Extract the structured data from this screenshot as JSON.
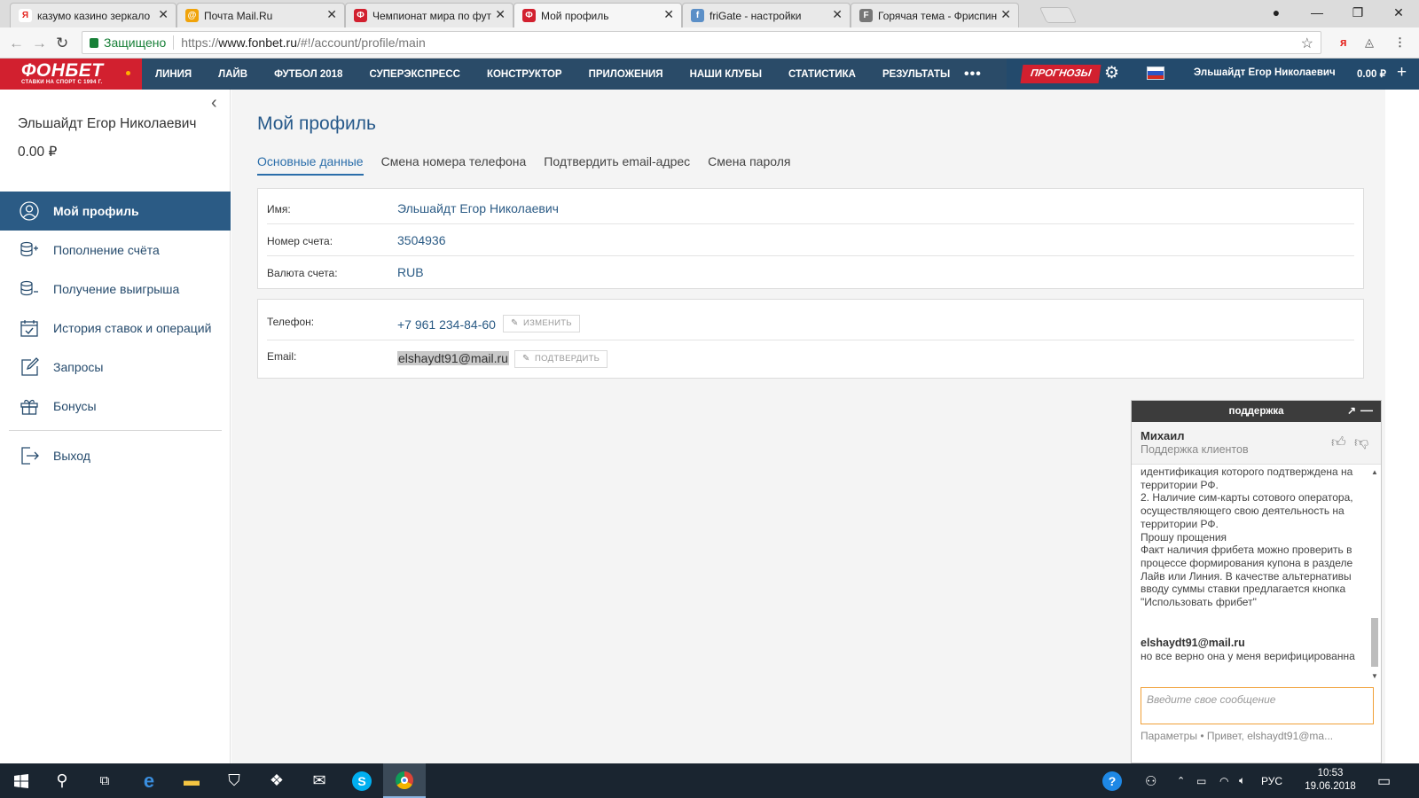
{
  "browser": {
    "tabs": [
      {
        "title": "казумо казино зеркало",
        "favicon": "yandex-icon",
        "favicon_color": "#e52620",
        "favicon_text": "Я"
      },
      {
        "title": "Почта Mail.Ru",
        "favicon": "mail-icon",
        "favicon_color": "#f0a30a",
        "favicon_text": "@"
      },
      {
        "title": "Чемпионат мира по фут",
        "favicon": "fonbet-icon",
        "favicon_color": "#d2202f",
        "favicon_text": "Ф"
      },
      {
        "title": "Мой профиль",
        "favicon": "fonbet-icon",
        "favicon_color": "#d2202f",
        "favicon_text": "Ф",
        "active": true
      },
      {
        "title": "friGate - настройки",
        "favicon": "frigate-icon",
        "favicon_color": "#5b8fc7",
        "favicon_text": "f"
      },
      {
        "title": "Горячая тема - Фриспин",
        "favicon": "forum-icon",
        "favicon_color": "#777777",
        "favicon_text": "F"
      }
    ],
    "secure_label": "Защищено",
    "url_scheme": "https://",
    "url_host": "www.fonbet.ru",
    "url_path": "/#!/account/profile/main"
  },
  "site": {
    "logo_text": "ФОНБЕТ",
    "logo_tagline": "СТАВКИ НА СПОРТ С 1994 Г.",
    "nav": [
      "ЛИНИЯ",
      "ЛАЙВ",
      "ФУТБОЛ 2018",
      "СУПЕРЭКСПРЕСС",
      "КОНСТРУКТОР",
      "ПРИЛОЖЕНИЯ",
      "НАШИ КЛУБЫ",
      "СТАТИСТИКА",
      "РЕЗУЛЬТАТЫ"
    ],
    "more": "•••",
    "forecasts": "ПРОГНОЗЫ",
    "user": "Эльшайдт Егор Николаевич",
    "balance": "0.00 ₽",
    "brand_red": "#d2202f",
    "brand_blue": "#2a4b68"
  },
  "sidebar": {
    "name": "Эльшайдт Егор Николаевич",
    "balance": "0.00 ₽",
    "items": [
      {
        "label": "Мой профиль",
        "icon": "user-icon"
      },
      {
        "label": "Пополнение счёта",
        "icon": "coins-deposit-icon"
      },
      {
        "label": "Получение выигрыша",
        "icon": "coins-withdraw-icon"
      },
      {
        "label": "История ставок и операций",
        "icon": "calendar-check-icon"
      },
      {
        "label": "Запросы",
        "icon": "edit-icon"
      },
      {
        "label": "Бонусы",
        "icon": "gift-icon"
      }
    ],
    "logout": "Выход"
  },
  "profile": {
    "title": "Мой профиль",
    "tabs": [
      "Основные данные",
      "Смена номера телефона",
      "Подтвердить email-адрес",
      "Смена пароля"
    ],
    "fields": [
      {
        "label": "Имя:",
        "value": "Эльшайдт Егор Николаевич"
      },
      {
        "label": "Номер счета:",
        "value": "3504936"
      },
      {
        "label": "Валюта счета:",
        "value": "RUB"
      }
    ],
    "phone_label": "Телефон:",
    "phone_value": "+7 961 234-84-60",
    "phone_action": "ИЗМЕНИТЬ",
    "email_label": "Email:",
    "email_value": "elshaydt91@mail.ru",
    "email_action": "ПОДТВЕРДИТЬ"
  },
  "chat": {
    "header": "поддержка",
    "agent_name": "Михаил",
    "agent_role": "Поддержка клиентов",
    "agent_message": "идентификация которого подтверждена на территории РФ.\n2. Наличие сим-карты сотового оператора, осуществляющего свою деятельность на территории РФ.\nПрошу прощения\nФакт наличия фрибета можно проверить в процессе формирования купона в разделе Лайв или Линия. В качестве альтернативы вводу суммы ставки предлагается кнопка \"Использовать фрибет\"",
    "user_author": "elshaydt91@mail.ru",
    "user_message": "но все верно она у меня верифицированна",
    "input_placeholder": "Введите свое сообщение",
    "footer_params": "Параметры",
    "footer_greeting": "Привет, elshaydt91@ma..."
  },
  "taskbar": {
    "language": "РУС",
    "time": "10:53",
    "date": "19.06.2018"
  }
}
